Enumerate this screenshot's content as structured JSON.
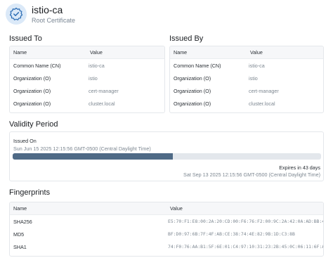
{
  "header": {
    "title": "istio-ca",
    "subtitle": "Root Certificate",
    "icon": "certificate-badge-icon"
  },
  "issued_to": {
    "title": "Issued To",
    "columns": [
      "Name",
      "Value"
    ],
    "rows": [
      {
        "name": "Common Name (CN)",
        "value": "istio-ca"
      },
      {
        "name": "Organization (O)",
        "value": "istio"
      },
      {
        "name": "Organization (O)",
        "value": "cert-manager"
      },
      {
        "name": "Organization (O)",
        "value": "cluster.local"
      }
    ]
  },
  "issued_by": {
    "title": "Issued By",
    "columns": [
      "Name",
      "Value"
    ],
    "rows": [
      {
        "name": "Common Name (CN)",
        "value": "istio-ca"
      },
      {
        "name": "Organization (O)",
        "value": "istio"
      },
      {
        "name": "Organization (O)",
        "value": "cert-manager"
      },
      {
        "name": "Organization (O)",
        "value": "cluster.local"
      }
    ]
  },
  "validity": {
    "title": "Validity Period",
    "issued_label": "Issued On",
    "issued_date": "Sun Jun 15 2025 12:15:56 GMT-0500 (Central Daylight Time)",
    "progress_fraction": 0.52,
    "expires_label": "Expires in 43 days",
    "expires_date": "Sat Sep 13 2025 12:15:56 GMT-0500 (Central Daylight Time)",
    "colors": {
      "fill": "#4f6a86",
      "track": "#e3e7ec"
    }
  },
  "fingerprints": {
    "title": "Fingerprints",
    "columns": [
      "Name",
      "Value"
    ],
    "rows": [
      {
        "name": "SHA256",
        "value": "E5:70:F1:E8:00:2A:20:CD:00:F6:76:F2:00:9C:2A:42:0A:AD:BB:49:C..."
      },
      {
        "name": "MD5",
        "value": "BF:D0:97:6B:7F:4F:AB:CE:38:74:4E:82:9B:1D:C3:8B"
      },
      {
        "name": "SHA1",
        "value": "74:F0:76:AA:B1:5F:6E:01:C4:97:10:31:23:2B:45:0C:06:11:6F:A1"
      }
    ]
  }
}
